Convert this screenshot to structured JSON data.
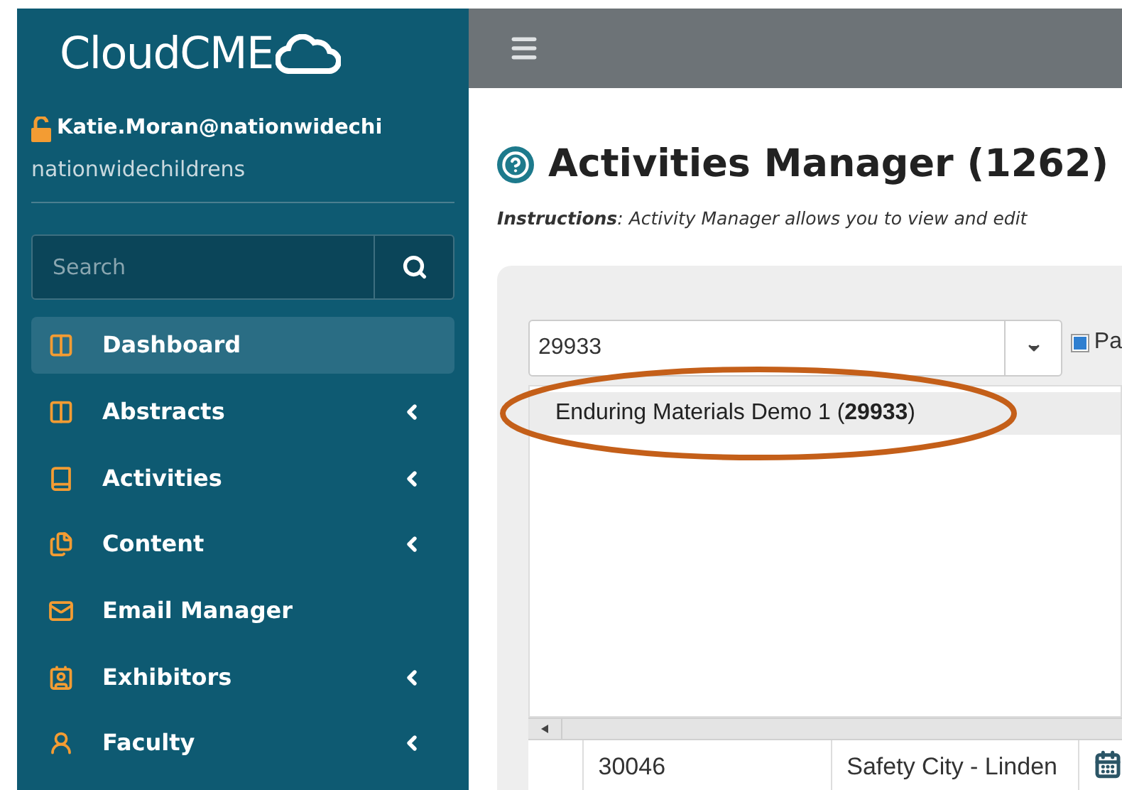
{
  "sidebar": {
    "logo": "CloudCME",
    "user": {
      "email": "Katie.Moran@nationwidechi",
      "org": "nationwidechildrens"
    },
    "search": {
      "placeholder": "Search"
    },
    "items": [
      {
        "label": "Dashboard",
        "kind": "columns",
        "selected": true,
        "submenu": false
      },
      {
        "label": "Abstracts",
        "kind": "columns",
        "selected": false,
        "submenu": true
      },
      {
        "label": "Activities",
        "kind": "book",
        "selected": false,
        "submenu": true
      },
      {
        "label": "Content",
        "kind": "files",
        "selected": false,
        "submenu": true
      },
      {
        "label": "Email Manager",
        "kind": "mail",
        "selected": false,
        "submenu": false
      },
      {
        "label": "Exhibitors",
        "kind": "contact",
        "selected": false,
        "submenu": true
      },
      {
        "label": "Faculty",
        "kind": "person",
        "selected": false,
        "submenu": true
      }
    ]
  },
  "page": {
    "title": "Activities Manager (1262)",
    "instructions": "**Instructions**: Activity Manager allows you to view and edit",
    "combo": {
      "value": "29933"
    },
    "checkbox": {
      "label": "Pa",
      "checked": true
    },
    "options": [
      {
        "text": "Enduring Materials Demo 1 (**29933**)",
        "selected": true
      }
    ],
    "row": [
      "30046",
      "Safety City - Linden"
    ]
  }
}
